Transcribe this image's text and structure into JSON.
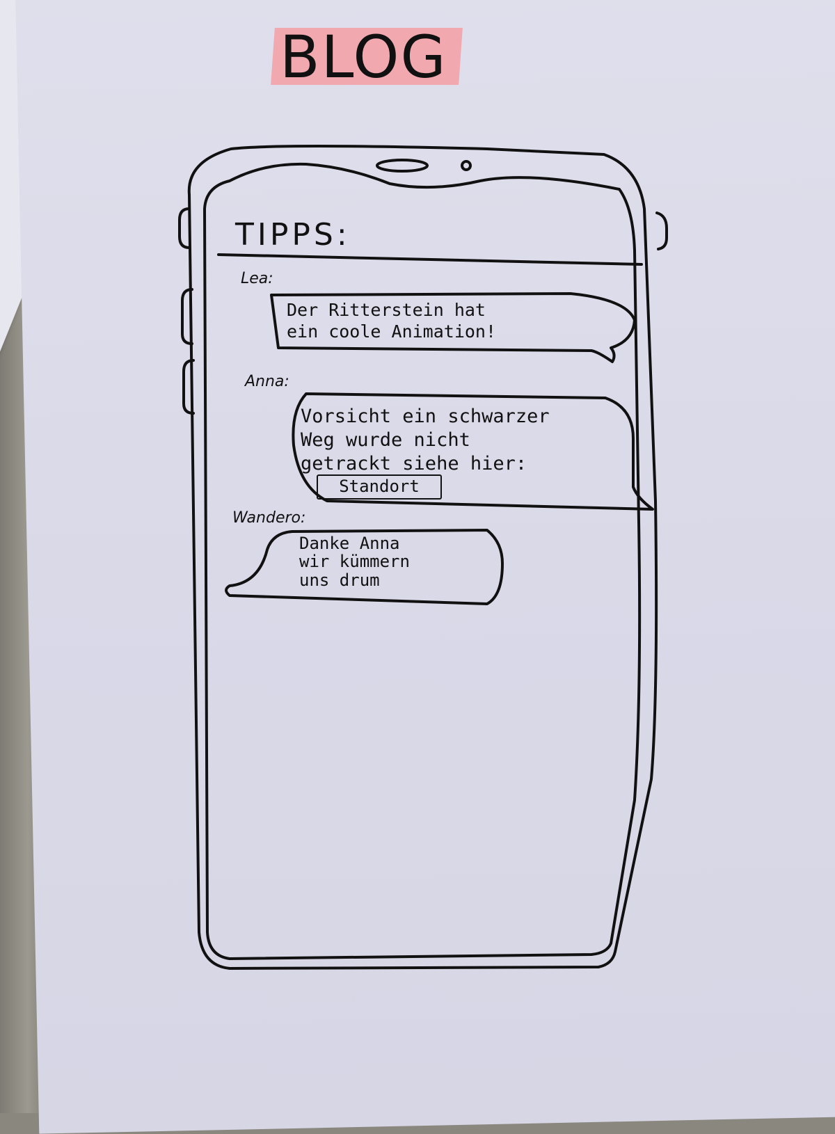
{
  "page_title": "BLOG",
  "screen": {
    "title": "TIPPS:"
  },
  "messages": [
    {
      "author": "Lea:",
      "text": "Der Ritterstein hat\nein coole Animation!"
    },
    {
      "author": "Anna:",
      "text": "Vorsicht ein schwarzer\nWeg wurde nicht\ngetrackt siehe hier:",
      "button_label": "Standort"
    },
    {
      "author": "Wandero:",
      "text": "Danke Anna\nwir kümmern\nuns drum"
    }
  ],
  "colors": {
    "highlighter": "#f2a3a8",
    "paper": "#dcdcea",
    "ink": "#111111"
  }
}
